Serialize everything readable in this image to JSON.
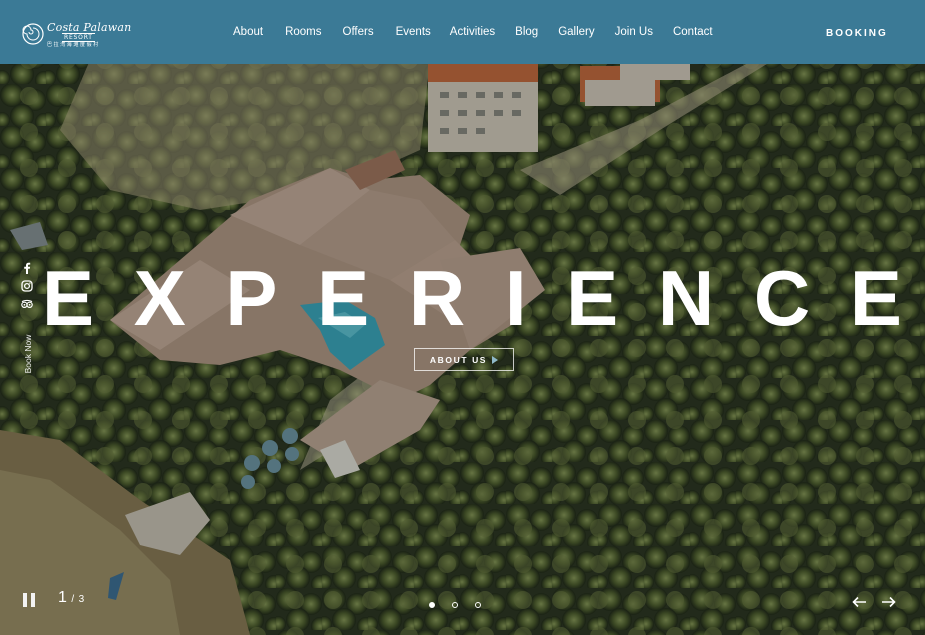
{
  "header": {
    "logo": {
      "title": "Costa Palawan",
      "subtitle": "RESORT",
      "chinese": "巴拉湾海滩度假村"
    },
    "nav": [
      {
        "label": "About"
      },
      {
        "label": "Rooms"
      },
      {
        "label": "Offers"
      },
      {
        "label": "Events"
      },
      {
        "label": "Activities"
      },
      {
        "label": "Blog"
      },
      {
        "label": "Gallery"
      },
      {
        "label": "Join Us"
      },
      {
        "label": "Contact"
      }
    ],
    "booking_label": "BOOKING",
    "background_color": "#3b7a96"
  },
  "hero": {
    "headline_letters": [
      "E",
      "X",
      "P",
      "E",
      "R",
      "I",
      "E",
      "N",
      "C",
      "E"
    ],
    "cta_label": "ABOUT US",
    "cta_icon": "play-triangle-icon",
    "cta_icon_color": "#8fb9c9"
  },
  "social": {
    "icons": [
      "facebook-icon",
      "instagram-icon",
      "tripadvisor-icon"
    ],
    "book_now_label": "Book Now"
  },
  "slider": {
    "current": "1",
    "separator": "/",
    "total": "3",
    "dots": [
      true,
      false,
      false
    ],
    "pause_icon": "pause-icon",
    "prev_icon": "arrow-left-icon",
    "next_icon": "arrow-right-icon"
  }
}
